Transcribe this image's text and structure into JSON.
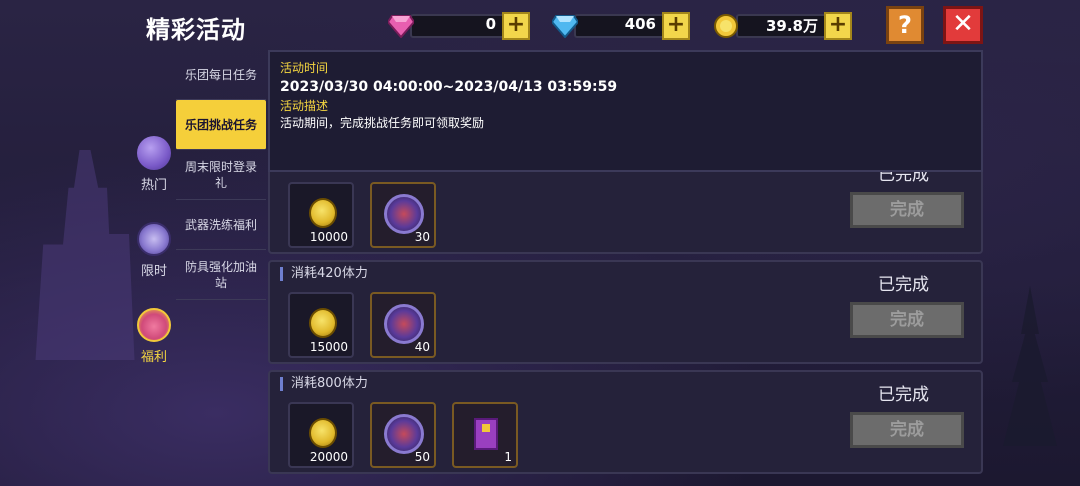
{
  "header": {
    "title": "精彩活动",
    "resources": [
      {
        "name": "pink-gem",
        "value": "0",
        "color": "#e85fb0"
      },
      {
        "name": "blue-diamond",
        "value": "406",
        "color": "#4fb8f0"
      },
      {
        "name": "gold-coin",
        "value": "39.8万",
        "color": "#f2c83a"
      }
    ],
    "help_label": "?",
    "close_label": "✕"
  },
  "categories": [
    {
      "label": "热门",
      "icon": "hot-blob-icon",
      "active": false
    },
    {
      "label": "限时",
      "icon": "stopwatch-icon",
      "active": false
    },
    {
      "label": "福利",
      "icon": "gift-bag-icon",
      "active": true
    }
  ],
  "subtabs": [
    {
      "label": "乐团每日任务",
      "active": false
    },
    {
      "label": "乐团挑战任务",
      "active": true
    },
    {
      "label": "周末限时登录礼",
      "active": false
    },
    {
      "label": "武器洗练福利",
      "active": false
    },
    {
      "label": "防具强化加油站",
      "active": false
    }
  ],
  "info": {
    "time_label": "活动时间",
    "time_value": "2023/03/30 04:00:00~2023/04/13 03:59:59",
    "desc_label": "活动描述",
    "desc_value": "活动期间，完成挑战任务即可领取奖励"
  },
  "tasks": [
    {
      "name": "",
      "status": "已完成",
      "button": "完成",
      "rewards": [
        {
          "icon": "gold-coin-icon",
          "count": "10000"
        },
        {
          "icon": "badge-icon",
          "count": "30"
        }
      ]
    },
    {
      "name": "消耗420体力",
      "status": "已完成",
      "button": "完成",
      "rewards": [
        {
          "icon": "gold-coin-icon",
          "count": "15000"
        },
        {
          "icon": "badge-icon",
          "count": "40"
        }
      ]
    },
    {
      "name": "消耗800体力",
      "status": "已完成",
      "button": "完成",
      "rewards": [
        {
          "icon": "gold-coin-icon",
          "count": "20000"
        },
        {
          "icon": "badge-icon",
          "count": "50"
        },
        {
          "icon": "purple-book-icon",
          "count": "1"
        }
      ]
    }
  ]
}
